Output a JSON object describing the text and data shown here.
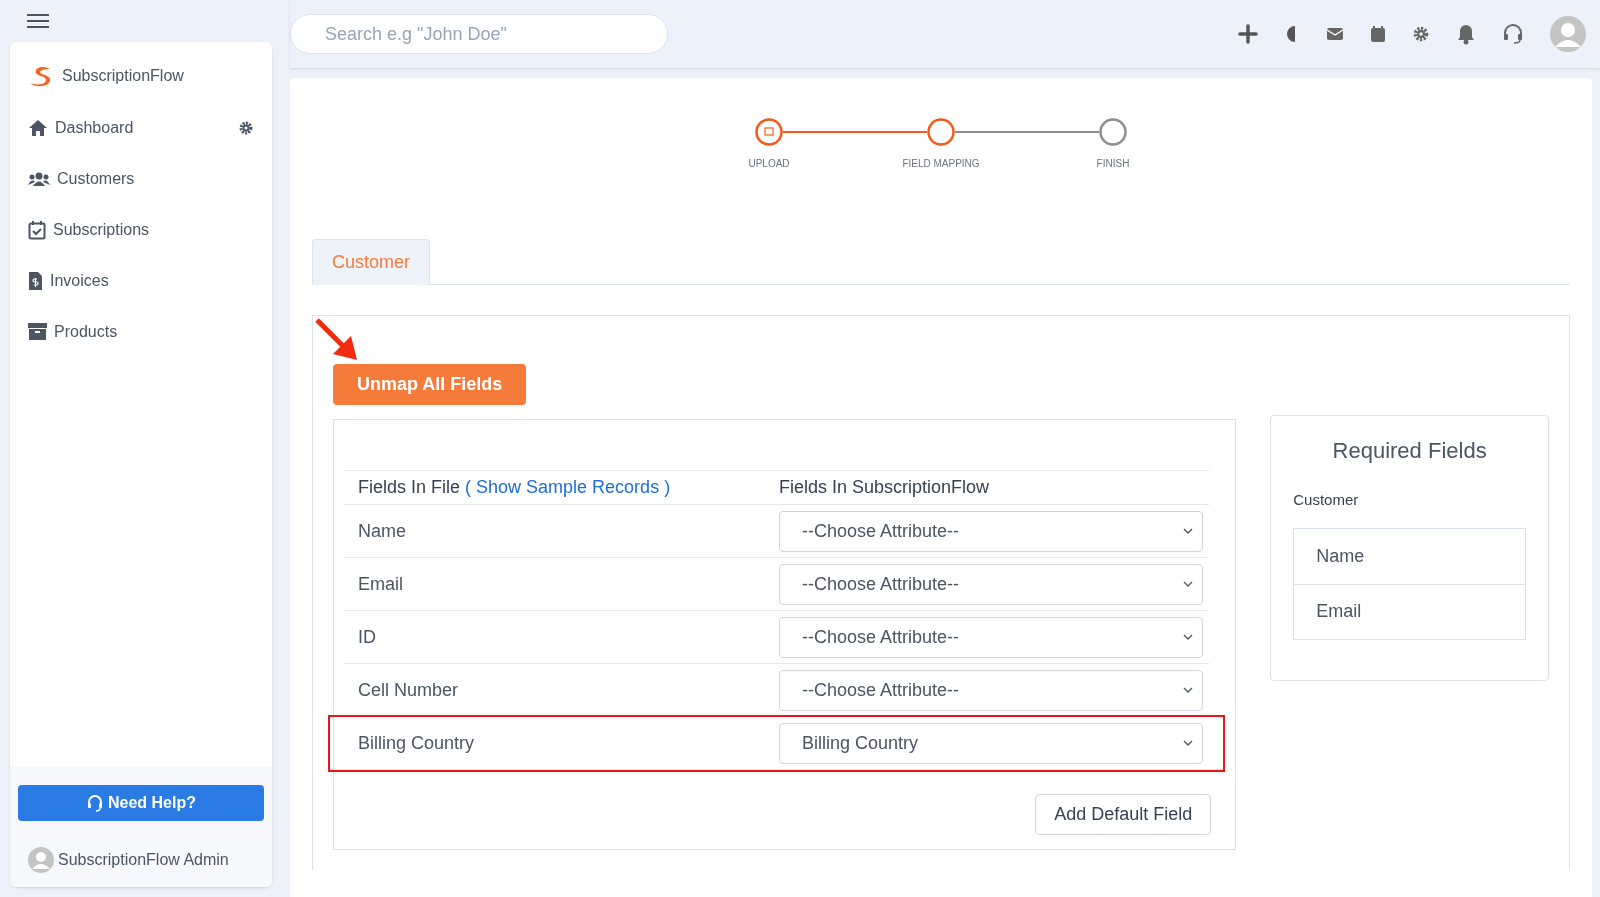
{
  "topbar": {
    "search": {
      "placeholder": "Search e.g \"John Doe\""
    }
  },
  "sidebar": {
    "brand": "SubscriptionFlow",
    "items": [
      {
        "label": "Dashboard",
        "settings": true
      },
      {
        "label": "Customers",
        "settings": false
      },
      {
        "label": "Subscriptions",
        "settings": false
      },
      {
        "label": "Invoices",
        "settings": false
      },
      {
        "label": "Products",
        "settings": false
      }
    ],
    "help_button": "Need Help?",
    "user": "SubscriptionFlow Admin"
  },
  "stepper": [
    {
      "label": "UPLOAD",
      "reached": true,
      "done": true
    },
    {
      "label": "FIELD MAPPING",
      "reached": true,
      "done": false
    },
    {
      "label": "FINISH",
      "reached": false,
      "done": false
    }
  ],
  "tabs": [
    {
      "label": "Customer",
      "selected": true
    }
  ],
  "unmap_button": "Unmap All Fields",
  "mapping": {
    "columns": [
      "Fields In File **( Show Sample Records )**",
      "Fields In SubscriptionFlow"
    ],
    "rows": [
      {
        "field": "Name",
        "attribute": "--Choose Attribute--",
        "highlighted": false
      },
      {
        "field": "Email",
        "attribute": "--Choose Attribute--",
        "highlighted": false
      },
      {
        "field": "ID",
        "attribute": "--Choose Attribute--",
        "highlighted": false
      },
      {
        "field": "Cell Number",
        "attribute": "--Choose Attribute--",
        "highlighted": false
      },
      {
        "field": "Billing Country",
        "attribute": "Billing Country",
        "highlighted": true
      }
    ],
    "add_button": "Add Default Field"
  },
  "required": {
    "title": "Required Fields",
    "group": "Customer",
    "fields": [
      "Name",
      "Email"
    ]
  }
}
